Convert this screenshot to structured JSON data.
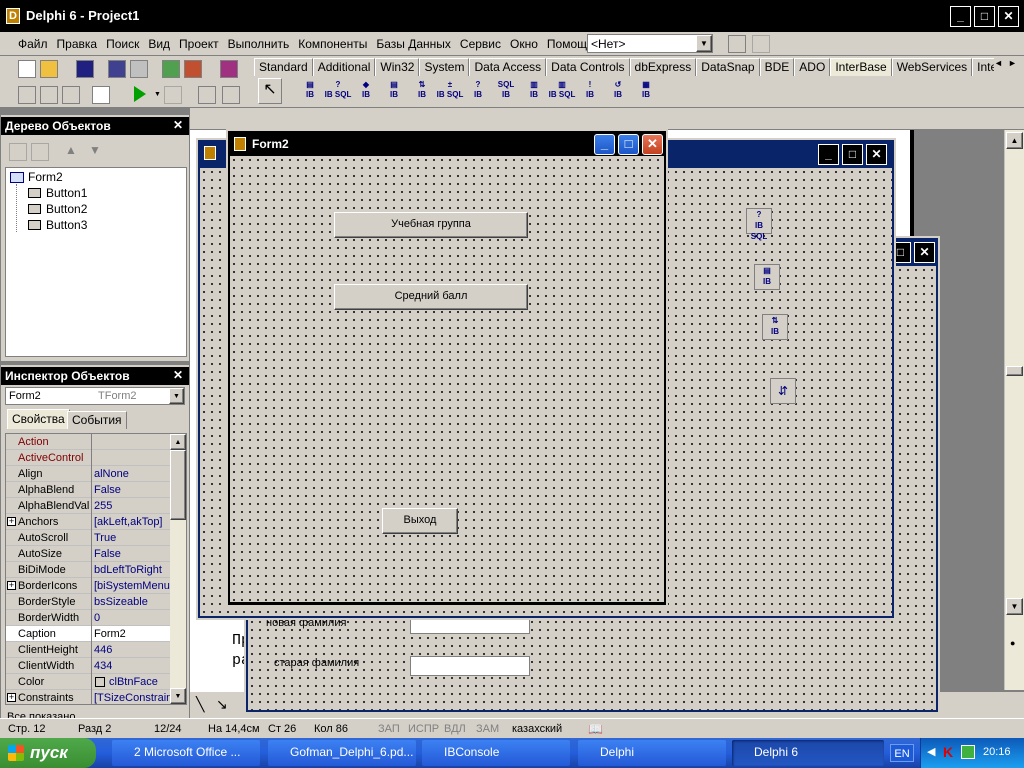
{
  "ide": {
    "title": "Delphi 6 - Project1",
    "menu": [
      "Файл",
      "Правка",
      "Поиск",
      "Вид",
      "Проект",
      "Выполнить",
      "Компоненты",
      "Базы Данных",
      "Сервис",
      "Окно",
      "Помощь"
    ],
    "desktop_combo": "<Нет>",
    "palette_tabs": [
      "Standard",
      "Additional",
      "Win32",
      "System",
      "Data Access",
      "Data Controls",
      "dbExpress",
      "DataSnap",
      "BDE",
      "ADO",
      "InterBase",
      "WebServices",
      "Internet"
    ],
    "active_tab": "InterBase"
  },
  "object_tree": {
    "title": "Дерево Объектов",
    "root": "Form2",
    "children": [
      "Button1",
      "Button2",
      "Button3"
    ]
  },
  "inspector": {
    "title": "Инспектор Объектов",
    "selected_name": "Form2",
    "selected_type": "TForm2",
    "tabs": [
      "Свойства",
      "События"
    ],
    "properties": [
      {
        "name": "Action",
        "value": "",
        "red": true
      },
      {
        "name": "ActiveControl",
        "value": "",
        "red": true
      },
      {
        "name": "Align",
        "value": "alNone"
      },
      {
        "name": "AlphaBlend",
        "value": "False"
      },
      {
        "name": "AlphaBlendVal",
        "value": "255"
      },
      {
        "name": "Anchors",
        "value": "[akLeft,akTop]",
        "plus": true
      },
      {
        "name": "AutoScroll",
        "value": "True"
      },
      {
        "name": "AutoSize",
        "value": "False"
      },
      {
        "name": "BiDiMode",
        "value": "bdLeftToRight"
      },
      {
        "name": "BorderIcons",
        "value": "[biSystemMenu,",
        "plus": true
      },
      {
        "name": "BorderStyle",
        "value": "bsSizeable"
      },
      {
        "name": "BorderWidth",
        "value": "0"
      },
      {
        "name": "Caption",
        "value": "Form2",
        "selected": true
      },
      {
        "name": "ClientHeight",
        "value": "446"
      },
      {
        "name": "ClientWidth",
        "value": "434"
      },
      {
        "name": "Color",
        "value": "clBtnFace"
      },
      {
        "name": "Constraints",
        "value": "[TSizeConstrain",
        "plus": true
      }
    ],
    "status": "Все показано"
  },
  "form2": {
    "title": "Form2",
    "buttons": [
      "Учебная группа",
      "Средний балл",
      "Выход"
    ]
  },
  "back_form": {
    "labels": [
      "новая фамилия",
      "старая фамилия"
    ]
  },
  "doc_fragments": [
    "Пр",
    "ра"
  ],
  "statusbar": {
    "page": "Стр. 12",
    "section": "Разд 2",
    "pages": "12/24",
    "at": "На 14,4см",
    "line": "Ст 26",
    "col": "Кол 86",
    "flags": [
      "ЗАП",
      "ИСПР",
      "ВДЛ",
      "ЗАМ"
    ],
    "lang": "казахский"
  },
  "taskbar": {
    "start": "пуск",
    "items": [
      "2 Microsoft Office ...",
      "Gofman_Delphi_6.pd...",
      "IBConsole",
      "Delphi",
      "Delphi 6"
    ],
    "active": "Delphi 6",
    "lang": "EN",
    "time": "20:16"
  }
}
